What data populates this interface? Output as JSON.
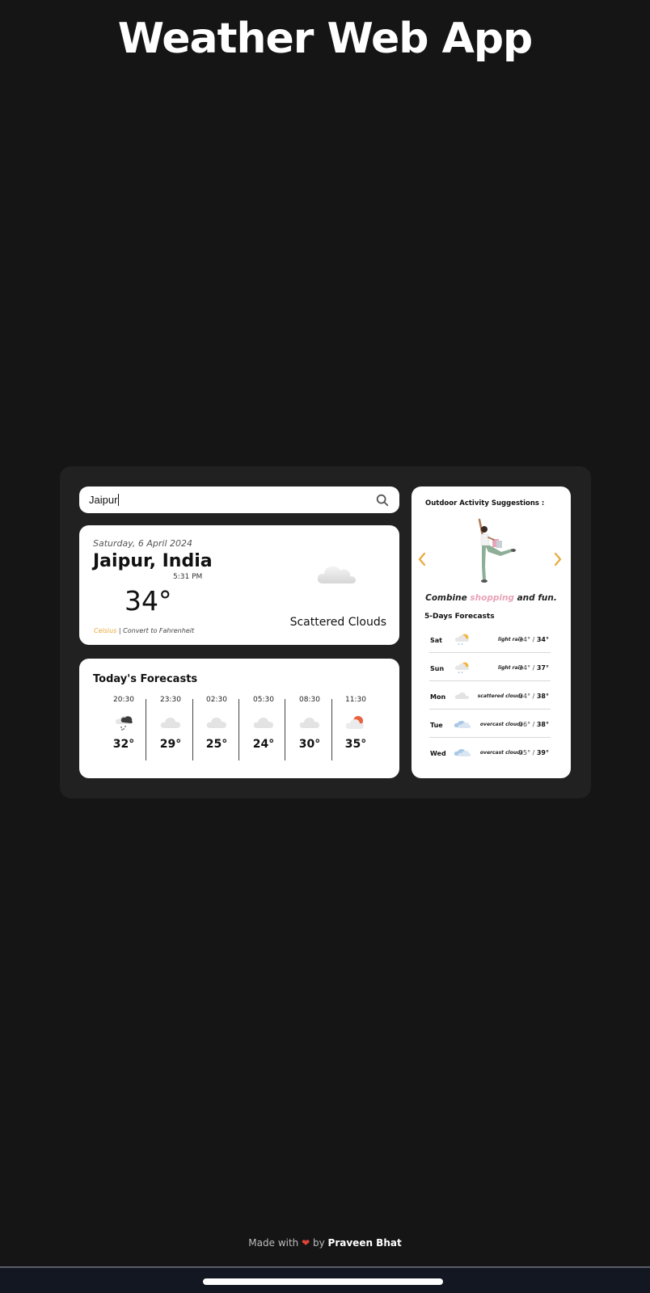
{
  "app": {
    "title": "Weather Web App"
  },
  "search": {
    "value": "Jaipur"
  },
  "current": {
    "date": "Saturday, 6 April 2024",
    "city": "Jaipur, India",
    "time": "5:31 PM",
    "temp": "34°",
    "unit_active": "Celsius",
    "unit_separator": " | ",
    "unit_convert": "Convert to Fahrenheit",
    "description": "Scattered Clouds",
    "icon": "cloud-icon"
  },
  "today": {
    "title": "Today's Forecasts",
    "hours": [
      {
        "time": "20:30",
        "temp": "32°",
        "icon": "rain-cloud-icon"
      },
      {
        "time": "23:30",
        "temp": "29°",
        "icon": "cloud-icon"
      },
      {
        "time": "02:30",
        "temp": "25°",
        "icon": "cloud-icon"
      },
      {
        "time": "05:30",
        "temp": "24°",
        "icon": "cloud-icon"
      },
      {
        "time": "08:30",
        "temp": "30°",
        "icon": "cloud-icon"
      },
      {
        "time": "11:30",
        "temp": "35°",
        "icon": "sun-cloud-icon"
      }
    ]
  },
  "activity": {
    "title": "Outdoor Activity Suggestions :",
    "caption_pre": "Combine ",
    "caption_highlight": "shopping",
    "caption_post": " and fun."
  },
  "five_day": {
    "title": "5-Days Forecasts",
    "days": [
      {
        "day": "Sat",
        "desc": "light rain",
        "min": "24°",
        "max": "34°",
        "icon": "sun-rain-icon"
      },
      {
        "day": "Sun",
        "desc": "light rain",
        "min": "24°",
        "max": "37°",
        "icon": "sun-rain-icon"
      },
      {
        "day": "Mon",
        "desc": "scattered clouds",
        "min": "24°",
        "max": "38°",
        "icon": "cloud-icon"
      },
      {
        "day": "Tue",
        "desc": "overcast clouds",
        "min": "26°",
        "max": "38°",
        "icon": "overcast-icon"
      },
      {
        "day": "Wed",
        "desc": "overcast clouds",
        "min": "25°",
        "max": "39°",
        "icon": "overcast-icon"
      }
    ]
  },
  "footer": {
    "pre": "Made with",
    "post": "by",
    "author": "Praveen Bhat"
  },
  "colors": {
    "accent": "#e9a93a",
    "highlight": "#e9a3b8",
    "background": "#151515",
    "panel": "#212121"
  }
}
